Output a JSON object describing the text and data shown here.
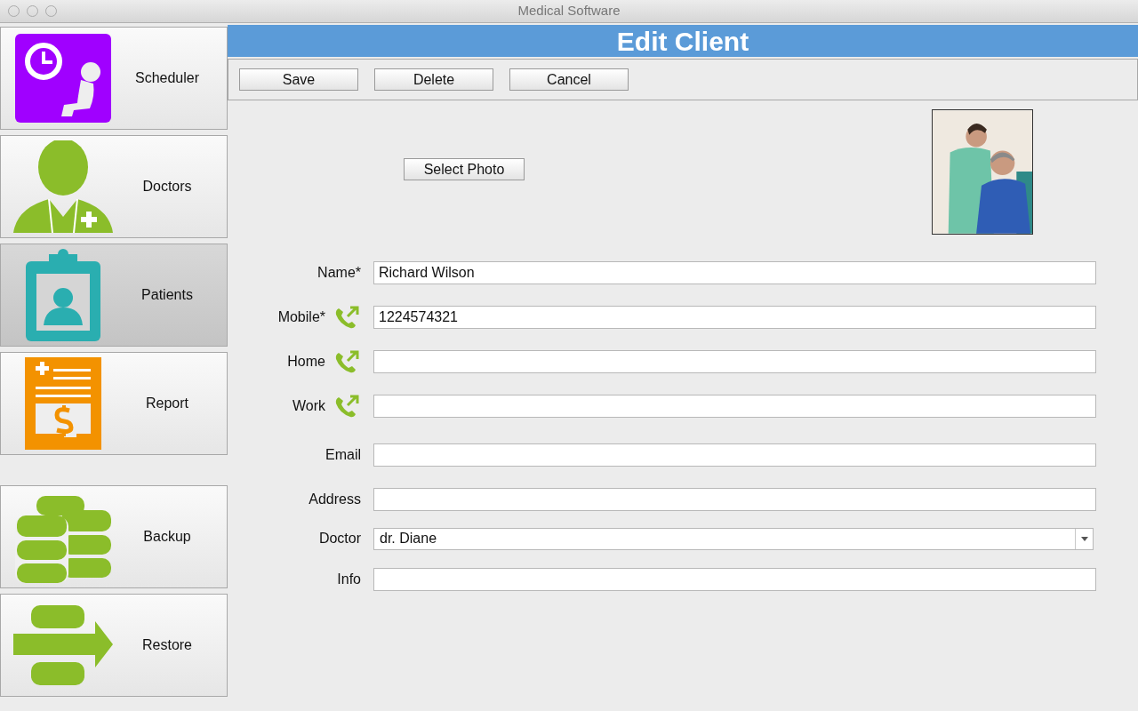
{
  "window": {
    "title": "Medical Software"
  },
  "sidebar": {
    "items": [
      {
        "label": "Scheduler",
        "selected": false
      },
      {
        "label": "Doctors",
        "selected": false
      },
      {
        "label": "Patients",
        "selected": true
      },
      {
        "label": "Report",
        "selected": false
      }
    ],
    "tools": [
      {
        "label": "Backup"
      },
      {
        "label": "Restore"
      }
    ]
  },
  "header": {
    "title": "Edit Client"
  },
  "toolbar": {
    "buttons": [
      "Save",
      "Delete",
      "Cancel"
    ]
  },
  "photo": {
    "button": "Select Photo",
    "kind": "picture"
  },
  "form": {
    "fields": [
      {
        "label": "Name*",
        "kind": "text",
        "value": "Richard Wilson"
      },
      {
        "label": "Mobile*",
        "kind": "phone",
        "value": "1224574321"
      },
      {
        "label": "Home",
        "kind": "phone"
      },
      {
        "label": "Work",
        "kind": "phone"
      },
      {
        "label": "Email",
        "kind": "text"
      },
      {
        "label": "Address",
        "kind": "text"
      },
      {
        "label": "Doctor",
        "kind": "select",
        "value": "dr. Diane"
      },
      {
        "label": "Info",
        "kind": "text"
      }
    ]
  }
}
